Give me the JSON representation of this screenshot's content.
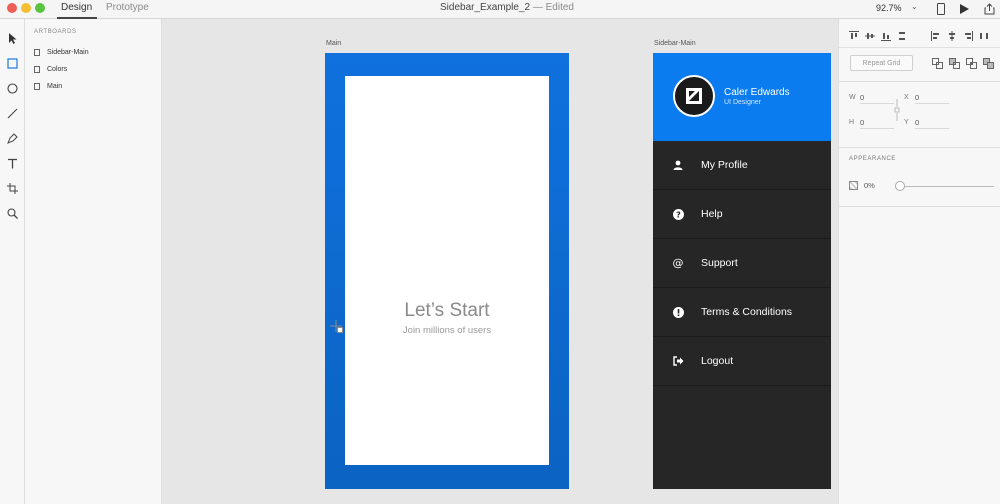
{
  "titlebar": {
    "tabs": [
      {
        "label": "Design",
        "active": true
      },
      {
        "label": "Prototype",
        "active": false
      }
    ],
    "document_name": "Sidebar_Example_2",
    "document_status": "— Edited",
    "zoom": "92.7%"
  },
  "layers": {
    "header": "ARTBOARDS",
    "items": [
      "Sidebar-Main",
      "Colors",
      "Main"
    ]
  },
  "canvas": {
    "main_artboard": {
      "label": "Main",
      "title": "Let’s Start",
      "subtitle": "Join millions of users",
      "gradient_top": "#0f71de",
      "gradient_bottom": "#0b63c2"
    },
    "sidebar_artboard": {
      "label": "Sidebar-Main",
      "user_name": "Caler Edwards",
      "user_role": "UI Designer",
      "header_color": "#0b7bf0",
      "menu_color": "#262626",
      "menu": [
        {
          "label": "My Profile",
          "icon": "user-icon"
        },
        {
          "label": "Help",
          "icon": "question-icon"
        },
        {
          "label": "Support",
          "icon": "at-icon"
        },
        {
          "label": "Terms & Conditions",
          "icon": "exclamation-icon"
        },
        {
          "label": "Logout",
          "icon": "logout-icon"
        }
      ]
    }
  },
  "properties": {
    "repeat_grid_label": "Repeat Grid",
    "w_label": "W",
    "w_value": "0",
    "x_label": "X",
    "x_value": "0",
    "h_label": "H",
    "h_value": "0",
    "y_label": "Y",
    "y_value": "0",
    "appearance_header": "APPEARANCE",
    "opacity": "0%"
  }
}
